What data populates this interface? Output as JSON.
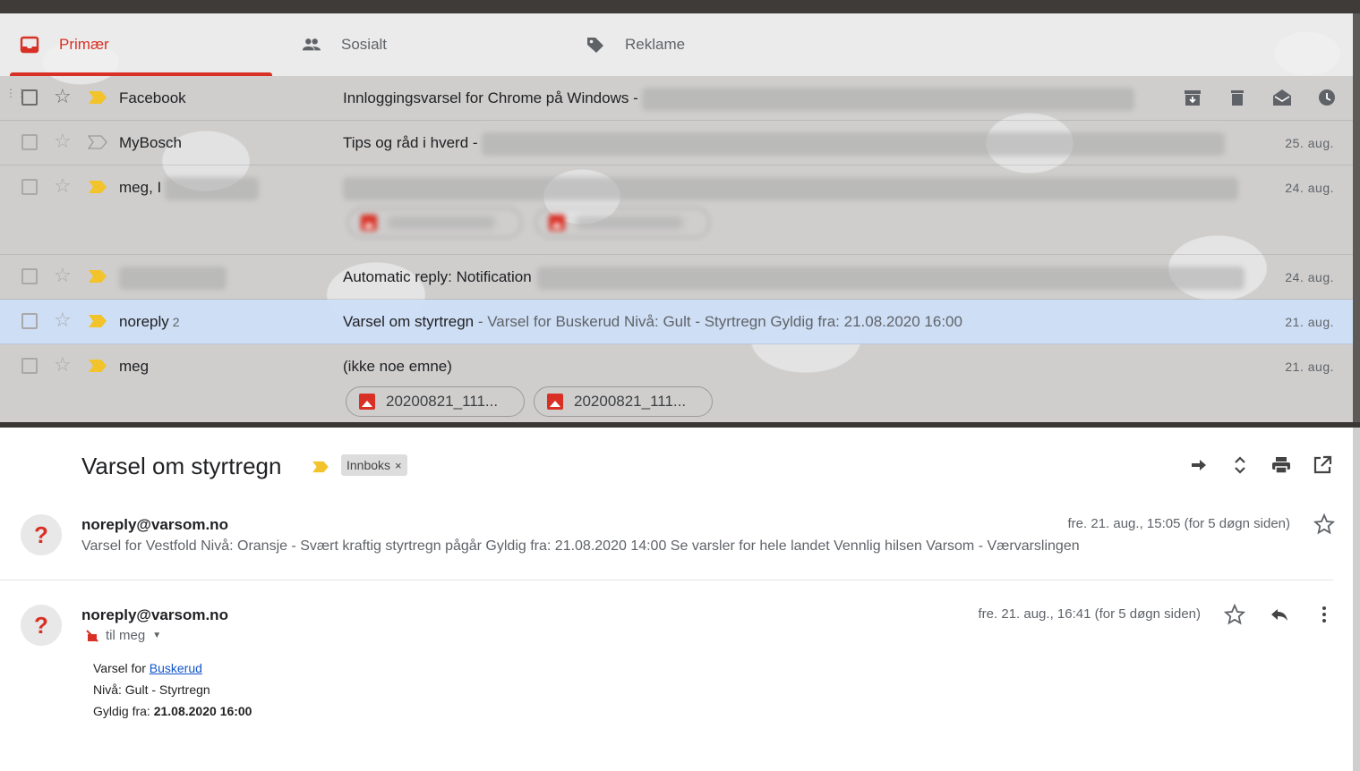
{
  "tabs": [
    {
      "label": "Primær",
      "icon": "inbox-icon",
      "active": true
    },
    {
      "label": "Sosialt",
      "icon": "people-icon",
      "active": false
    },
    {
      "label": "Reklame",
      "icon": "tag-icon",
      "active": false
    }
  ],
  "rows": [
    {
      "sender": "Facebook",
      "count": "",
      "subject": "Innloggingsvarsel for Chrome på Windows - ",
      "snippet": "",
      "date": "",
      "unread": true,
      "important": true
    },
    {
      "sender": "MyBosch",
      "count": "",
      "subject": "Tips og råd i hverd - ",
      "snippet": "",
      "date": "25. aug.",
      "unread": false,
      "important": false
    },
    {
      "sender": "meg, I",
      "count": "",
      "subject": "",
      "snippet": "",
      "date": "24. aug.",
      "unread": false,
      "important": true
    },
    {
      "sender": "",
      "count": "",
      "subject": "Automatic reply: Notification",
      "snippet": "",
      "date": "24. aug.",
      "unread": false,
      "important": true
    },
    {
      "sender": "noreply",
      "count": "2",
      "subject": "Varsel om styrtregn",
      "snippet": " - Varsel for Buskerud Nivå: Gult - Styrtregn Gyldig fra: 21.08.2020 16:00",
      "date": "21. aug.",
      "unread": false,
      "important": true
    },
    {
      "sender": "meg",
      "count": "",
      "subject": "(ikke noe emne)",
      "snippet": "",
      "date": "21. aug.",
      "unread": false,
      "important": true
    }
  ],
  "attachments": {
    "row6": [
      "20200821_111...",
      "20200821_111..."
    ]
  },
  "hover_actions": [
    "archive-icon",
    "delete-icon",
    "mark-read-icon",
    "snooze-icon"
  ],
  "thread": {
    "title": "Varsel om styrtregn",
    "label": "Innboks",
    "label_remove": "×",
    "actions": [
      "forward-arrow-icon",
      "expand-icon",
      "print-icon",
      "open-new-window-icon"
    ]
  },
  "messages": [
    {
      "from": "noreply@varsom.no",
      "date": "fre. 21. aug., 15:05 (for 5 døgn siden)",
      "snippet": "Varsel for Vestfold Nivå: Oransje - Svært kraftig styrtregn pågår Gyldig fra: 21.08.2020 14:00 Se varsler for hele landet Vennlig hilsen Varsom - Værvarslingen",
      "avatar": "?"
    },
    {
      "from": "noreply@varsom.no",
      "date": "fre. 21. aug., 16:41 (for 5 døgn siden)",
      "to": "til meg",
      "avatar": "?",
      "body": {
        "line1_prefix": "Varsel for ",
        "line1_link": "Buskerud",
        "line2": "Nivå: Gult - Styrtregn",
        "line3_prefix": "Gyldig fra: ",
        "line3_value": "21.08.2020 16:00"
      }
    }
  ],
  "colors": {
    "accent": "#d93025",
    "important": "#f2c32a",
    "selected_row": "#cddef7",
    "link": "#1155cc"
  }
}
